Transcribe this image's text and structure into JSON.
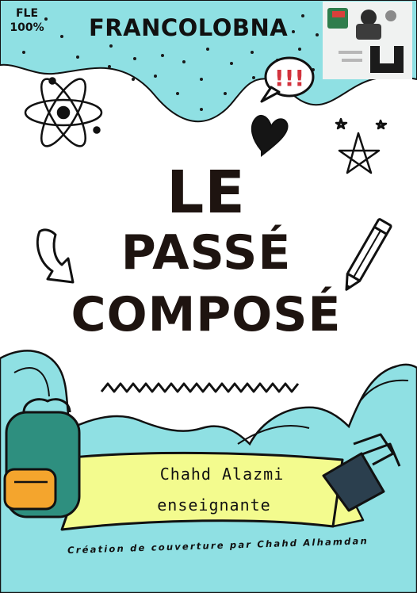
{
  "header": {
    "fle_line1": "FLE",
    "fle_line2": "100%",
    "brand": "FRANCOLOBNA"
  },
  "title": {
    "line1": "LE",
    "line2": "PASSÉ",
    "line3": "COMPOSÉ"
  },
  "banner": {
    "name": "Chahd Alazmi",
    "role": "enseignante"
  },
  "credit": "Création de couverture par Chahd Alhamdan",
  "colors": {
    "aqua": "#8fe0e3",
    "banner_yellow": "#f3fb8e",
    "backpack_teal": "#2e8f7f",
    "pocket_orange": "#f4a52d",
    "clip_navy": "#2b3f4e",
    "speech_red": "#d2333d"
  },
  "icons": [
    "atom-icon",
    "speech-bubble-icon",
    "heart-icon",
    "stars-icon",
    "curved-arrow-icon",
    "pencil-icon",
    "backpack-icon",
    "binder-clip-icon"
  ]
}
